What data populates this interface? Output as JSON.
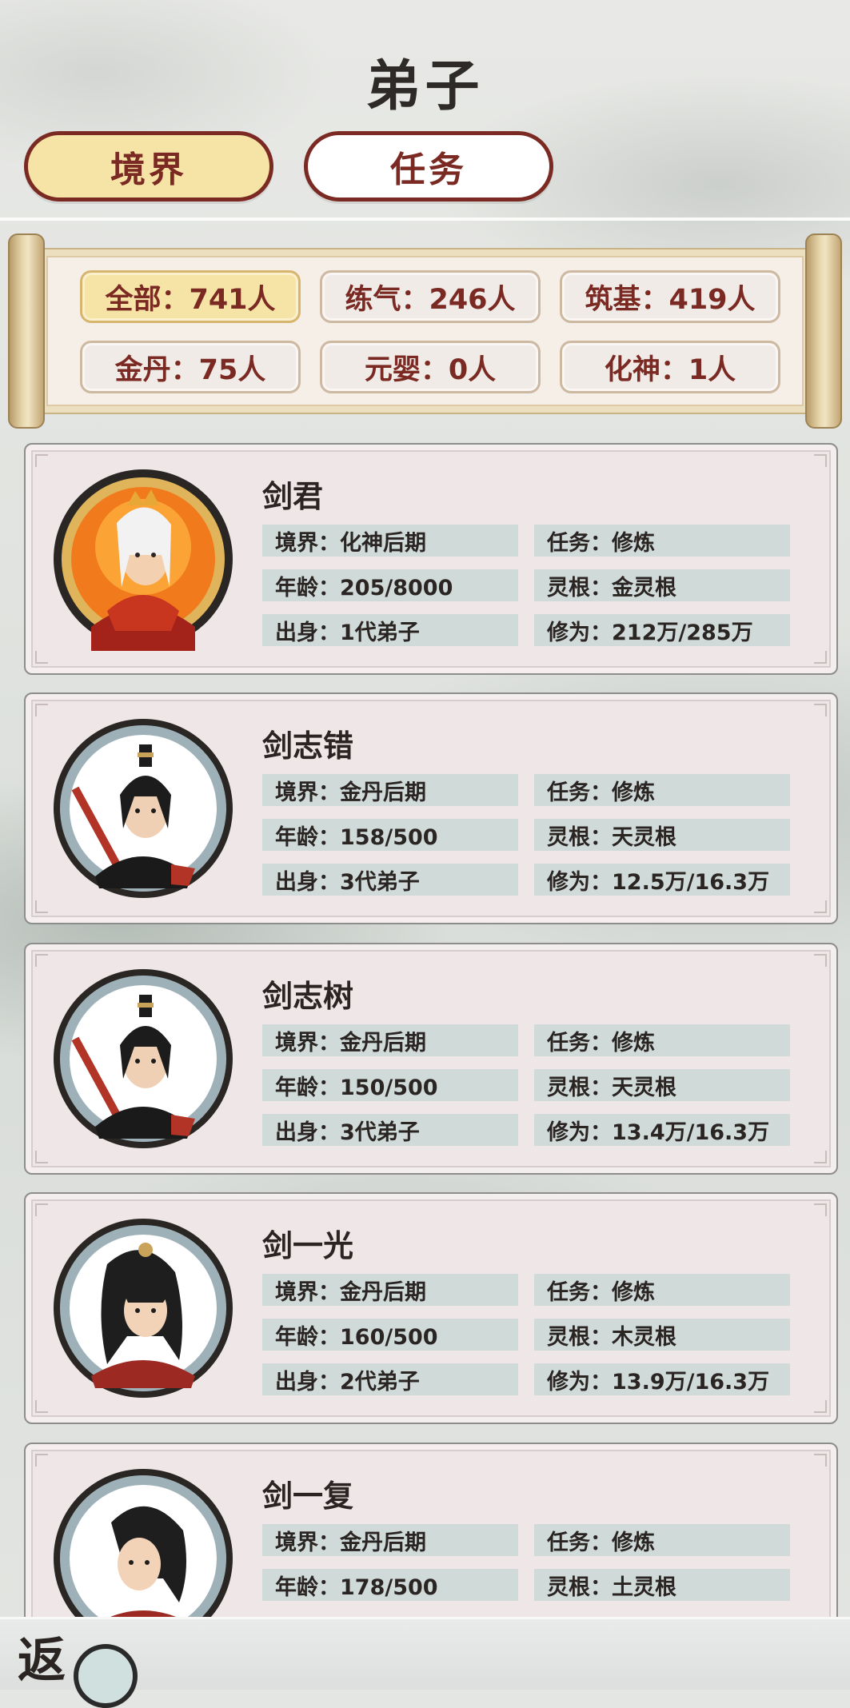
{
  "header": {
    "title": "弟子"
  },
  "tabs": [
    {
      "label": "境界",
      "active": true
    },
    {
      "label": "任务",
      "active": false
    }
  ],
  "stats": [
    {
      "label": "全部：741人",
      "selected": true
    },
    {
      "label": "练气：246人"
    },
    {
      "label": "筑基：419人"
    },
    {
      "label": "金丹：75人"
    },
    {
      "label": "元婴：0人"
    },
    {
      "label": "化神：1人"
    }
  ],
  "disciples": [
    {
      "name": "剑君",
      "realm": "境界：化神后期",
      "task": "任务：修炼",
      "age": "年龄：205/8000",
      "root": "灵根：金灵根",
      "origin": "出身：1代弟子",
      "cultivation": "修为：212万/285万",
      "avatar_icon": "fire-sovereign-portrait"
    },
    {
      "name": "剑志错",
      "realm": "境界：金丹后期",
      "task": "任务：修炼",
      "age": "年龄：158/500",
      "root": "灵根：天灵根",
      "origin": "出身：3代弟子",
      "cultivation": "修为：12.5万/16.3万",
      "avatar_icon": "swordsman-portrait"
    },
    {
      "name": "剑志树",
      "realm": "境界：金丹后期",
      "task": "任务：修炼",
      "age": "年龄：150/500",
      "root": "灵根：天灵根",
      "origin": "出身：3代弟子",
      "cultivation": "修为：13.4万/16.3万",
      "avatar_icon": "swordsman-portrait"
    },
    {
      "name": "剑一光",
      "realm": "境界：金丹后期",
      "task": "任务：修炼",
      "age": "年龄：160/500",
      "root": "灵根：木灵根",
      "origin": "出身：2代弟子",
      "cultivation": "修为：13.9万/16.3万",
      "avatar_icon": "female-cultivator-portrait"
    },
    {
      "name": "剑一复",
      "realm": "境界：金丹后期",
      "task": "任务：修炼",
      "age": "年龄：178/500",
      "root": "灵根：土灵根",
      "origin": "出身：",
      "cultivation": "修为：",
      "avatar_icon": "female-cultivator-portrait"
    }
  ],
  "footer": {
    "back_label": "返"
  },
  "colors": {
    "accent": "#7a2a22",
    "tab_active": "#f6e3a6",
    "field_bg": "#cfdad9",
    "card_bg": "#efe7e7"
  }
}
